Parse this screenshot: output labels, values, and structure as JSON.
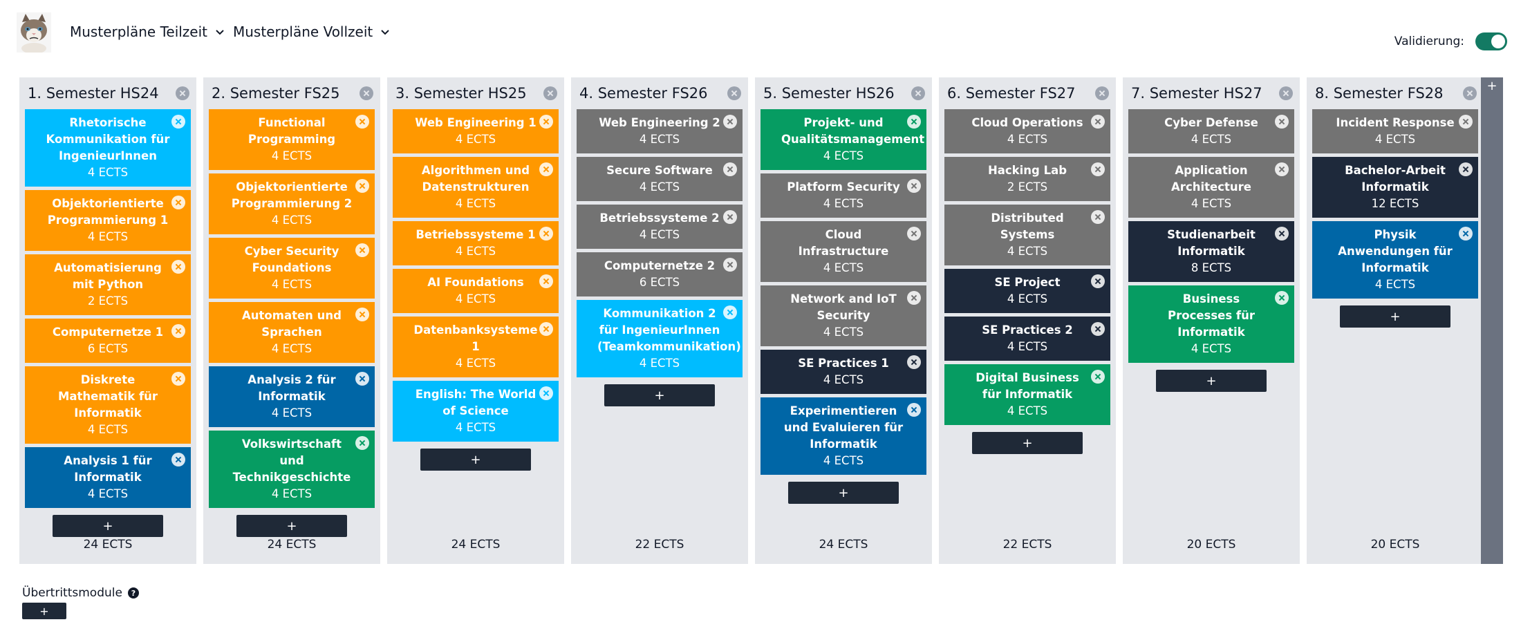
{
  "header": {
    "logo_icon": "grumpy-cat-avatar",
    "nav": [
      {
        "label": "Musterpläne Teilzeit",
        "icon": "chevron-down-icon"
      },
      {
        "label": "Musterpläne Vollzeit",
        "icon": "chevron-down-icon"
      }
    ],
    "validation": {
      "label": "Validierung:",
      "enabled": true,
      "color": "#137a63"
    }
  },
  "colors": {
    "orange": "#ff9800",
    "skyblue": "#00bcff",
    "blue": "#0066a6",
    "green": "#069c62",
    "gray": "#737373",
    "navy": "#1e293b"
  },
  "semesters": [
    {
      "title": "1. Semester HS24",
      "total": "24 ECTS",
      "modules": [
        {
          "name": "Rhetorische Kommunikation für IngenieurInnen",
          "ects": "4 ECTS",
          "color": "skyblue"
        },
        {
          "name": "Objektorientierte Programmierung 1",
          "ects": "4 ECTS",
          "color": "orange"
        },
        {
          "name": "Automatisierung mit Python",
          "ects": "2 ECTS",
          "color": "orange"
        },
        {
          "name": "Computernetze 1",
          "ects": "6 ECTS",
          "color": "orange"
        },
        {
          "name": "Diskrete Mathematik für Informatik",
          "ects": "4 ECTS",
          "color": "orange"
        },
        {
          "name": "Analysis 1 für Informatik",
          "ects": "4 ECTS",
          "color": "blue"
        }
      ]
    },
    {
      "title": "2. Semester FS25",
      "total": "24 ECTS",
      "modules": [
        {
          "name": "Functional Programming",
          "ects": "4 ECTS",
          "color": "orange"
        },
        {
          "name": "Objektorientierte Programmierung 2",
          "ects": "4 ECTS",
          "color": "orange"
        },
        {
          "name": "Cyber Security Foundations",
          "ects": "4 ECTS",
          "color": "orange"
        },
        {
          "name": "Automaten und Sprachen",
          "ects": "4 ECTS",
          "color": "orange"
        },
        {
          "name": "Analysis 2 für Informatik",
          "ects": "4 ECTS",
          "color": "blue"
        },
        {
          "name": "Volkswirtschaft und Technikgeschichte",
          "ects": "4 ECTS",
          "color": "green"
        }
      ]
    },
    {
      "title": "3. Semester HS25",
      "total": "24 ECTS",
      "modules": [
        {
          "name": "Web Engineering 1",
          "ects": "4 ECTS",
          "color": "orange"
        },
        {
          "name": "Algorithmen und Datenstrukturen",
          "ects": "4 ECTS",
          "color": "orange"
        },
        {
          "name": "Betriebssysteme 1",
          "ects": "4 ECTS",
          "color": "orange"
        },
        {
          "name": "AI Foundations",
          "ects": "4 ECTS",
          "color": "orange"
        },
        {
          "name": "Datenbanksysteme 1",
          "ects": "4 ECTS",
          "color": "orange"
        },
        {
          "name": "English: The World of Science",
          "ects": "4 ECTS",
          "color": "skyblue"
        }
      ]
    },
    {
      "title": "4. Semester FS26",
      "total": "22 ECTS",
      "modules": [
        {
          "name": "Web Engineering 2",
          "ects": "4 ECTS",
          "color": "gray"
        },
        {
          "name": "Secure Software",
          "ects": "4 ECTS",
          "color": "gray"
        },
        {
          "name": "Betriebssysteme 2",
          "ects": "4 ECTS",
          "color": "gray"
        },
        {
          "name": "Computernetze 2",
          "ects": "6 ECTS",
          "color": "gray"
        },
        {
          "name": "Kommunikation 2 für IngenieurInnen (Teamkommunikation)",
          "ects": "4 ECTS",
          "color": "skyblue"
        }
      ]
    },
    {
      "title": "5. Semester HS26",
      "total": "24 ECTS",
      "modules": [
        {
          "name": "Projekt- und Qualitätsmanagement",
          "ects": "4 ECTS",
          "color": "green"
        },
        {
          "name": "Platform Security",
          "ects": "4 ECTS",
          "color": "gray"
        },
        {
          "name": "Cloud Infrastructure",
          "ects": "4 ECTS",
          "color": "gray"
        },
        {
          "name": "Network and IoT Security",
          "ects": "4 ECTS",
          "color": "gray"
        },
        {
          "name": "SE Practices 1",
          "ects": "4 ECTS",
          "color": "navy"
        },
        {
          "name": "Experimentieren und Evaluieren für Informatik",
          "ects": "4 ECTS",
          "color": "blue"
        }
      ]
    },
    {
      "title": "6. Semester FS27",
      "total": "22 ECTS",
      "modules": [
        {
          "name": "Cloud Operations",
          "ects": "4 ECTS",
          "color": "gray"
        },
        {
          "name": "Hacking Lab",
          "ects": "2 ECTS",
          "color": "gray"
        },
        {
          "name": "Distributed Systems",
          "ects": "4 ECTS",
          "color": "gray"
        },
        {
          "name": "SE Project",
          "ects": "4 ECTS",
          "color": "navy"
        },
        {
          "name": "SE Practices 2",
          "ects": "4 ECTS",
          "color": "navy"
        },
        {
          "name": "Digital Business für Informatik",
          "ects": "4 ECTS",
          "color": "green"
        }
      ]
    },
    {
      "title": "7. Semester HS27",
      "total": "20 ECTS",
      "modules": [
        {
          "name": "Cyber Defense",
          "ects": "4 ECTS",
          "color": "gray"
        },
        {
          "name": "Application Architecture",
          "ects": "4 ECTS",
          "color": "gray"
        },
        {
          "name": "Studienarbeit Informatik",
          "ects": "8 ECTS",
          "color": "navy"
        },
        {
          "name": "Business Processes für Informatik",
          "ects": "4 ECTS",
          "color": "green"
        }
      ]
    },
    {
      "title": "8. Semester FS28",
      "total": "20 ECTS",
      "modules": [
        {
          "name": "Incident Response",
          "ects": "4 ECTS",
          "color": "gray"
        },
        {
          "name": "Bachelor-Arbeit Informatik",
          "ects": "12 ECTS",
          "color": "navy"
        },
        {
          "name": "Physik Anwendungen für Informatik",
          "ects": "4 ECTS",
          "color": "blue"
        }
      ]
    }
  ],
  "add_label": "+",
  "add_semester_label": "+",
  "footer": {
    "label": "Übertrittsmodule",
    "help_icon": "question-circle-icon",
    "help_glyph": "?",
    "add_label": "+"
  }
}
